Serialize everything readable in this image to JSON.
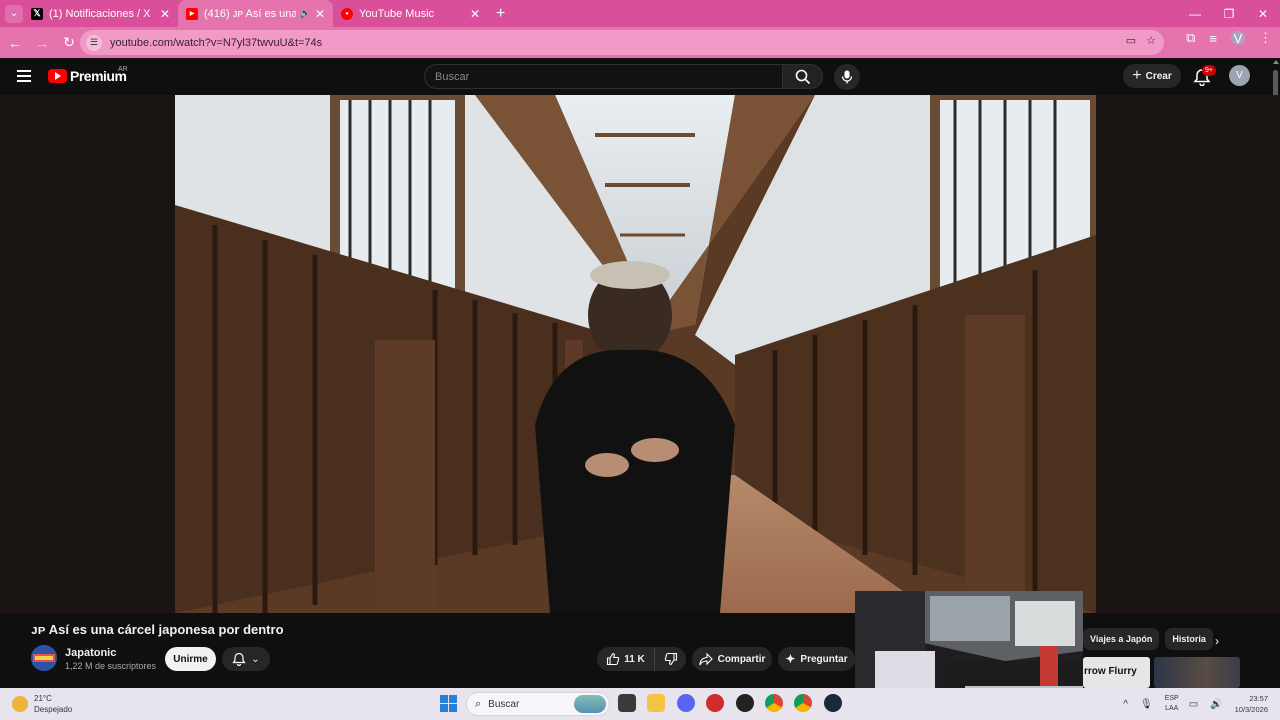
{
  "browser": {
    "tabs": [
      {
        "title": "(1) Notificaciones / X",
        "active": false
      },
      {
        "title": "(416) ᴊᴘ Así es una cárcel jap",
        "active": true
      },
      {
        "title": "YouTube Music",
        "active": false
      }
    ],
    "url": "youtube.com/watch?v=N7yl37twvuU&t=74s",
    "profile_initial": "V"
  },
  "youtube": {
    "logo_text": "Premium",
    "country": "AR",
    "search_placeholder": "Buscar",
    "create_label": "Crear",
    "notifications_badge": "9+",
    "avatar_initial": "V"
  },
  "video": {
    "title": "ᴊᴘ Así es una cárcel japonesa por dentro",
    "channel": "Japatonic",
    "subscribers": "1,22 M de suscriptores",
    "join_label": "Unirme",
    "likes": "11 K",
    "share_label": "Compartir",
    "ask_label": "Preguntar"
  },
  "sidebar": {
    "chips": [
      "Viajes a Japón",
      "Historia"
    ],
    "thumb_text": "rrow Flurry"
  },
  "taskbar": {
    "weather_temp": "21°C",
    "weather_desc": "Despejado",
    "search_label": "Buscar",
    "lang_line1": "ESP",
    "lang_line2": "LAA",
    "time": "23:57",
    "date": "10/3/2026"
  },
  "colors": {
    "browser_frame": "#d94f99",
    "browser_toolbar": "#e573ae",
    "youtube_red": "#ff0000",
    "page_bg": "#0f0f0f"
  }
}
